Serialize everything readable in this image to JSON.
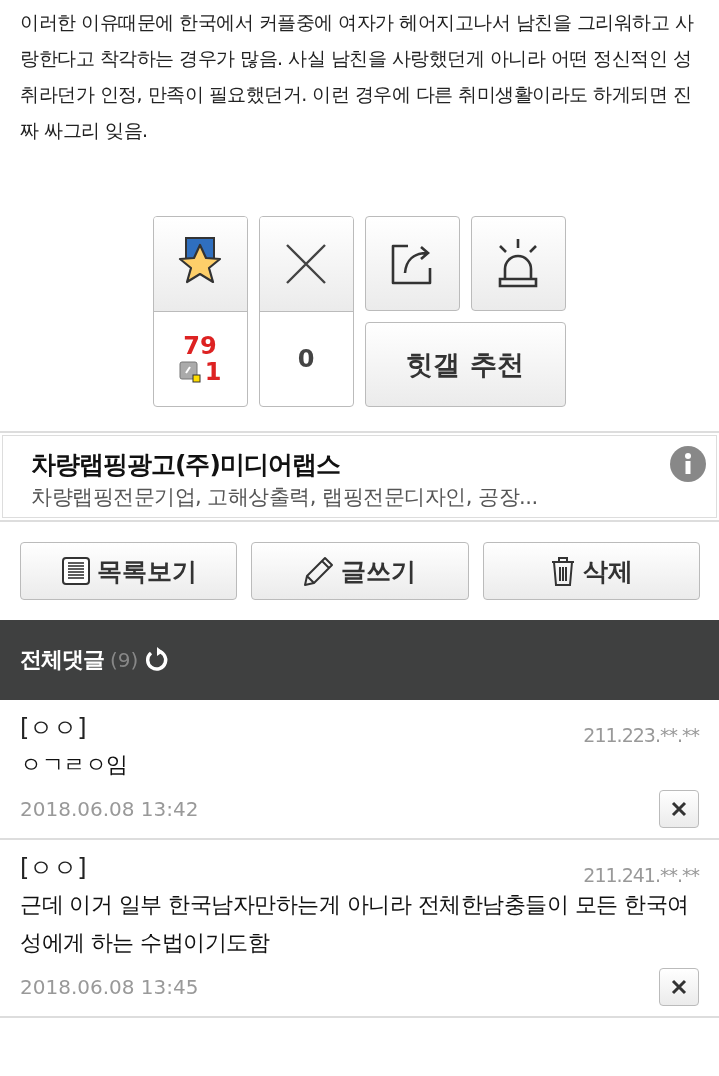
{
  "post": {
    "body": "이러한 이유때문에 한국에서 커플중에 여자가 헤어지고나서 남친을 그리워하고 사랑한다고 착각하는 경우가 많음. 사실 남친을 사랑했던게 아니라 어떤 정신적인 성취라던가 인정, 만족이 필요했던거. 이런 경우에 다른 취미생활이라도 하게되면 진짜 싸그리 잊음."
  },
  "vote": {
    "recommend_count": "79",
    "fixed_count": "1",
    "downvote_count": "0",
    "hit_button": "힛갤 추천"
  },
  "ad": {
    "title": "차량랩핑광고(주)미디어랩스",
    "description": "차량랩핑전문기업, 고해상출력, 랩핑전문디자인, 공장..."
  },
  "actions": [
    {
      "kind": "list",
      "label": "목록보기"
    },
    {
      "kind": "write",
      "label": "글쓰기"
    },
    {
      "kind": "delete",
      "label": "삭제"
    }
  ],
  "comments_header": {
    "title": "전체댓글",
    "count": "(9)"
  },
  "comments": [
    {
      "author": "[ㅇㅇ]",
      "ip": "211.223.**.**",
      "text": "ㅇㄱㄹㅇ임",
      "date": "2018.06.08 13:42"
    },
    {
      "author": "[ㅇㅇ]",
      "ip": "211.241.**.**",
      "text": "근데 이거 일부 한국남자만하는게 아니라 전체한남충들이 모든 한국여성에게 하는 수법이기도함",
      "date": "2018.06.08 13:45"
    }
  ]
}
